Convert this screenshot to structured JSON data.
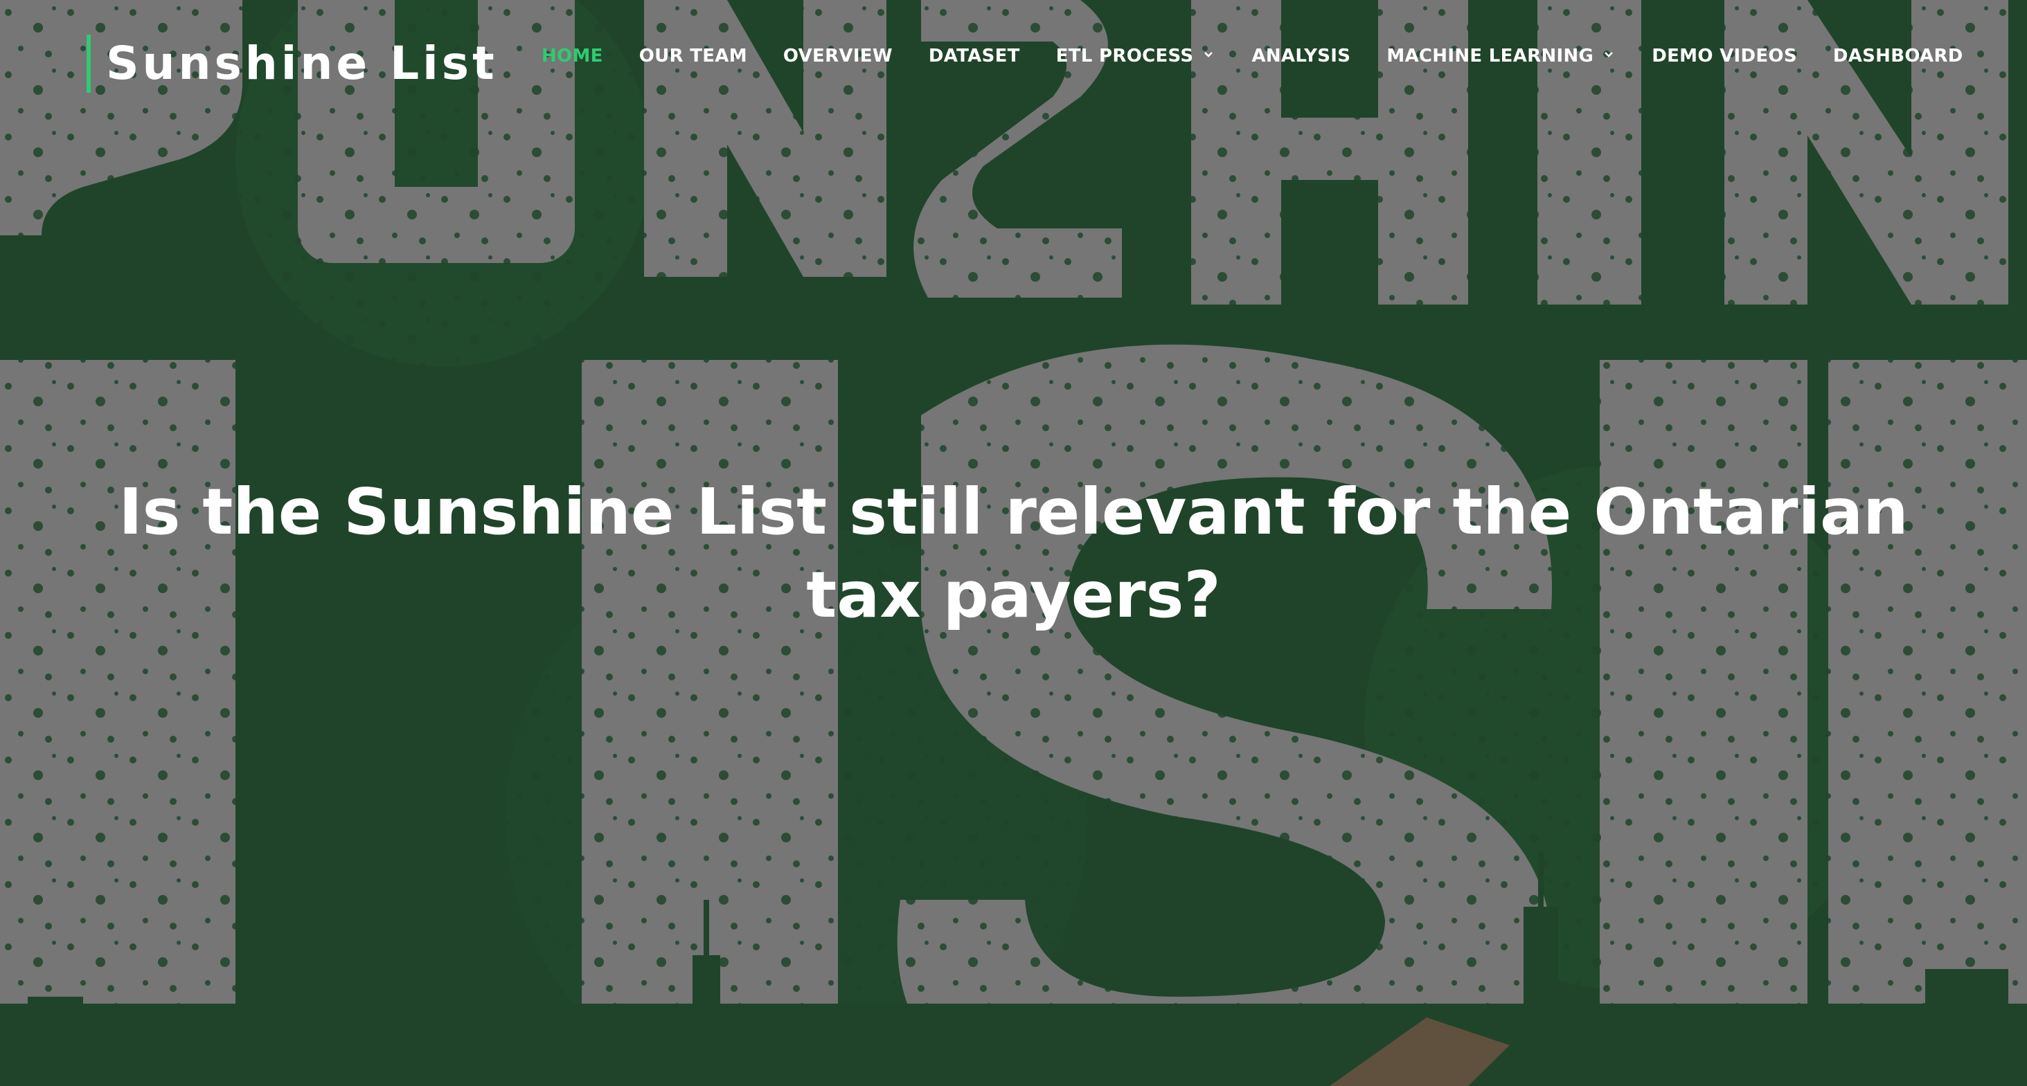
{
  "site": {
    "logo_text": "Sunshine List",
    "accent_color": "#2ecc71"
  },
  "nav": {
    "items": [
      {
        "label": "HOME",
        "active": true
      },
      {
        "label": "OUR TEAM"
      },
      {
        "label": "OVERVIEW"
      },
      {
        "label": "DATASET"
      },
      {
        "label": "ETL PROCESS",
        "icon": "chevron-down-icon"
      },
      {
        "label": "ANALYSIS"
      },
      {
        "label": "MACHINE LEARNING",
        "icon": "chevron-down-icon"
      },
      {
        "label": "DEMO VIDEOS"
      },
      {
        "label": "DASHBOARD"
      }
    ]
  },
  "hero": {
    "title": "Is the Sunshine List still relevant for the Ontarian tax payers?",
    "background_color": "#0b6a24"
  }
}
